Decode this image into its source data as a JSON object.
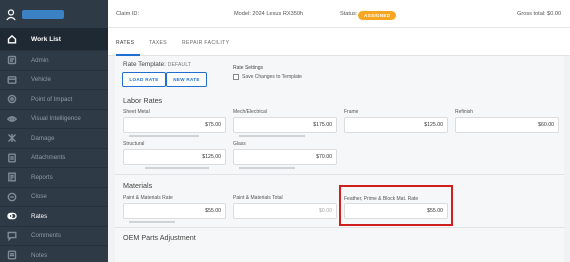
{
  "sidebar": {
    "items": [
      {
        "label": "Work List",
        "icon": "home-icon",
        "active": true
      },
      {
        "label": "Admin",
        "icon": "admin-icon"
      },
      {
        "label": "Vehicle",
        "icon": "vehicle-icon"
      },
      {
        "label": "Point of Impact",
        "icon": "target-icon"
      },
      {
        "label": "Visual Intelligence",
        "icon": "eye-icon"
      },
      {
        "label": "Damage",
        "icon": "damage-icon"
      },
      {
        "label": "Attachments",
        "icon": "attachment-icon"
      },
      {
        "label": "Reports",
        "icon": "report-icon"
      },
      {
        "label": "Close",
        "icon": "close-circle-icon"
      },
      {
        "label": "Rates",
        "icon": "rates-icon",
        "selected": true
      },
      {
        "label": "Comments",
        "icon": "comment-icon"
      },
      {
        "label": "Notes",
        "icon": "note-icon"
      }
    ]
  },
  "topbar": {
    "claim_label": "Claim ID:",
    "model_label": "Model: 2024 Lexus RX350h",
    "status_label": "Status:",
    "status_value": "ASSIGNED",
    "gross_label": "Gross total: $0.00"
  },
  "tabs": [
    {
      "label": "RATES",
      "active": true
    },
    {
      "label": "TAXES"
    },
    {
      "label": "REPAIR FACILITY"
    }
  ],
  "rate_template": {
    "label": "Rate Template:",
    "value": "DEFAULT",
    "load_button": "LOAD RATE",
    "new_button": "NEW RATE",
    "settings_title": "Rate Settings",
    "save_checkbox_label": "Save Changes to Template"
  },
  "labor_rates": {
    "title": "Labor Rates",
    "fields": [
      {
        "label": "Sheet Metal",
        "value": "$75.00"
      },
      {
        "label": "Mech/Electrical",
        "value": "$175.00"
      },
      {
        "label": "Frame",
        "value": "$125.00"
      },
      {
        "label": "Refinish",
        "value": "$60.00"
      },
      {
        "label": "Structural",
        "value": "$125.00"
      },
      {
        "label": "Glass",
        "value": "$70.00"
      }
    ]
  },
  "materials": {
    "title": "Materials",
    "fields": [
      {
        "label": "Paint & Materials Rate",
        "value": "$55.00"
      },
      {
        "label": "Paint & Materials Total",
        "value": "$0.00"
      },
      {
        "label": "Feather, Prime & Block Mat. Rate",
        "value": "$55.00"
      }
    ]
  },
  "oem": {
    "title": "OEM Parts Adjustment"
  },
  "colors": {
    "sidebar_bg": "#2f3a47",
    "accent": "#1f6fd1",
    "status_badge": "#f5a623",
    "highlight": "#d01d1d"
  }
}
